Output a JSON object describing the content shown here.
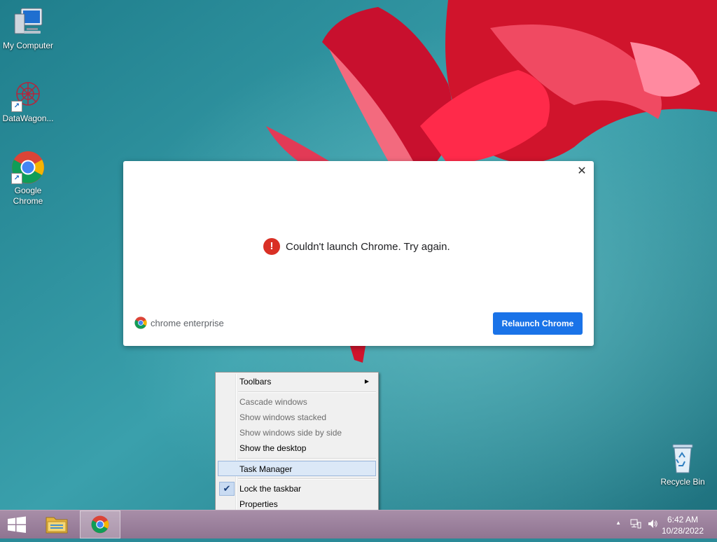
{
  "desktop": {
    "icons": [
      {
        "label": "My Computer"
      },
      {
        "label": "DataWagon..."
      },
      {
        "label_line1": "Google",
        "label_line2": "Chrome"
      },
      {
        "label": "Recycle Bin"
      }
    ]
  },
  "dialog": {
    "message": "Couldn't launch Chrome. Try again.",
    "brand": "chrome enterprise",
    "relaunch_label": "Relaunch Chrome",
    "close_glyph": "✕",
    "error_glyph": "!"
  },
  "context_menu": {
    "items": [
      {
        "label": "Toolbars",
        "submenu": true
      },
      {
        "label": "Cascade windows",
        "disabled": true
      },
      {
        "label": "Show windows stacked",
        "disabled": true
      },
      {
        "label": "Show windows side by side",
        "disabled": true
      },
      {
        "label": "Show the desktop"
      },
      {
        "label": "Task Manager",
        "highlighted": true
      },
      {
        "label": "Lock the taskbar",
        "checked": true
      },
      {
        "label": "Properties"
      }
    ]
  },
  "taskbar": {
    "clock_time": "6:42 AM",
    "clock_date": "10/28/2022"
  },
  "colors": {
    "accent": "#1a73e8",
    "error": "#d93025"
  }
}
